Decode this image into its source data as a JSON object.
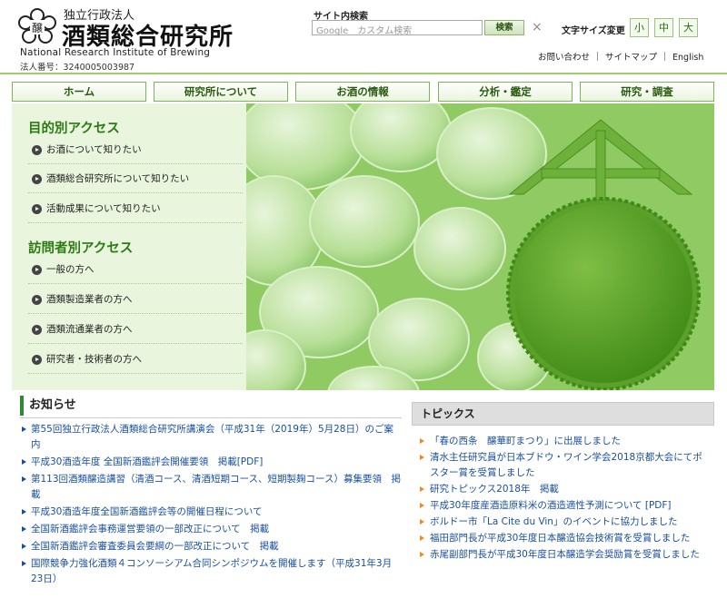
{
  "header": {
    "org_type": "独立行政法人",
    "org_name": "酒類総合研究所",
    "org_name_en": "National Research Institute of Brewing",
    "corp_number": "法人番号：3240005003987",
    "search_label": "サイト内検索",
    "search_placeholder": "Google　カスタム検索",
    "search_button": "検索",
    "search_clear": "×",
    "font_size_label": "文字サイズ変更",
    "font_sizes": [
      "小",
      "中",
      "大"
    ],
    "util_links": [
      "お問い合わせ",
      "サイトマップ",
      "English"
    ]
  },
  "nav": {
    "items": [
      "ホーム",
      "研究所について",
      "お酒の情報",
      "分析・鑑定",
      "研究・調査"
    ]
  },
  "access": {
    "purpose_heading": "目的別アクセス",
    "purpose_items": [
      "お酒について知りたい",
      "酒類総合研究所について知りたい",
      "活動成果について知りたい"
    ],
    "visitor_heading": "訪問者別アクセス",
    "visitor_items": [
      "一般の方へ",
      "酒類製造業者の方へ",
      "酒類流通業者の方へ",
      "研究者・技術者の方へ"
    ]
  },
  "news": {
    "title": "お知らせ",
    "items": [
      "第55回独立行政法人酒類総合研究所講演会（平成31年（2019年）5月28日）のご案内",
      "平成30酒造年度 全国新酒鑑評会開催要領　掲載[PDF]",
      "第113回酒類醸造講習（清酒コース、清酒短期コース、短期製麹コース）募集要領　掲載",
      "平成30酒造年度全国新酒鑑評会等の開催日程について",
      "全国新酒鑑評会事務運営要領の一部改正について　掲載",
      "全国新酒鑑評会審査委員会要綱の一部改正について　掲載",
      "国際競争力強化酒類４コンソーシアム合同シンポジウムを開催します（平成31年3月23日）"
    ]
  },
  "topics": {
    "title": "トピックス",
    "items": [
      "「春の西条　醸華町まつり」に出展しました",
      "清水主任研究員が日本ブドウ・ワイン学会2018京都大会にてポスター賞を受賞しました",
      "研究トピックス2018年　掲載",
      "平成30年度産酒造原料米の酒造適性予測について [PDF]",
      "ボルドー市「La Cite du Vin」のイベントに協力しました",
      "福田部門長が平成30年度日本醸造協会技術賞を受賞しました",
      "赤尾副部門長が平成30年度日本醸造学会奨励賞を受賞しました"
    ]
  },
  "colors": {
    "brand_green": "#2b7a12",
    "link_blue": "#1a4fa0",
    "topic_bullet": "#f08a1c",
    "panel_bg": "#e9f5dd"
  }
}
